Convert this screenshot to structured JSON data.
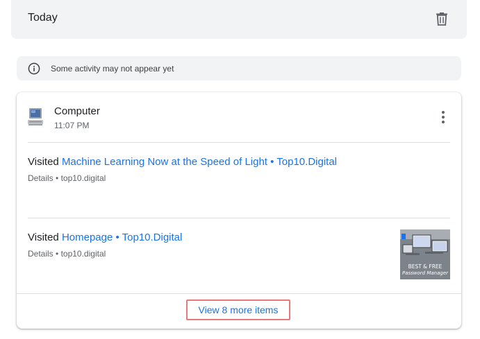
{
  "header": {
    "title": "Today",
    "delete_icon": "trash-icon"
  },
  "notice": {
    "icon": "info-icon",
    "text": "Some activity may not appear yet"
  },
  "activity": {
    "device": {
      "icon": "computer-icon",
      "name": "Computer",
      "time": "11:07 PM"
    },
    "menu_icon": "more-vert-icon",
    "items": [
      {
        "prefix": "Visited",
        "title": "Machine Learning Now at the Speed of Light • Top10.Digital",
        "details_label": "Details",
        "separator": " • ",
        "domain": "top10.digital"
      },
      {
        "prefix": "Visited",
        "title": "Homepage • Top10.Digital",
        "details_label": "Details",
        "separator": " • ",
        "domain": "top10.digital",
        "thumbnail": {
          "line1": "BEST & FREE",
          "line2": "Password Manager"
        }
      }
    ],
    "view_more_label": "View 8 more items"
  },
  "colors": {
    "link": "#1a73e8",
    "text_primary": "#202124",
    "text_secondary": "#5f6368",
    "surface": "#f1f3f4",
    "highlight_border": "#e8787a"
  }
}
